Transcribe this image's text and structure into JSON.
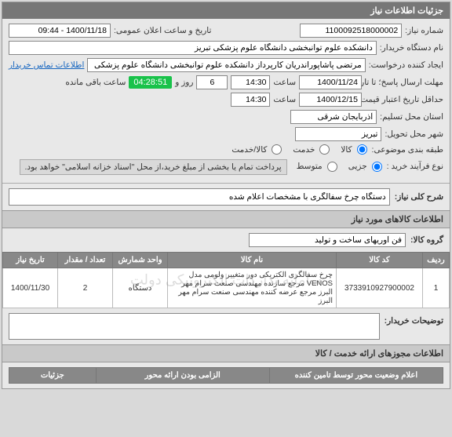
{
  "header": {
    "title": "جزئیات اطلاعات نیاز"
  },
  "form": {
    "need_no_label": "شماره نیاز:",
    "need_no": "1100092518000002",
    "announce_label": "تاریخ و ساعت اعلان عمومی:",
    "announce_value": "1400/11/18 - 09:44",
    "buyer_label": "نام دستگاه خریدار:",
    "buyer_value": "دانشکده علوم توانبخشی دانشگاه علوم پزشکی تبریز",
    "creator_label": "ایجاد کننده درخواست:",
    "creator_value": "مرتضی پاشاپوراندریان کارپرداز دانشکده علوم توانبخشی دانشگاه علوم پزشکی",
    "contact_link": "اطلاعات تماس خریدار",
    "deadline_answer_label": "مهلت ارسال پاسخ؛ تا تاریخ:",
    "deadline_date": "1400/11/24",
    "time_label": "ساعت",
    "deadline_time": "14:30",
    "days_label": "روز و",
    "days_value": "6",
    "remain_label": "ساعت باقی مانده",
    "remain_timer": "04:28:51",
    "min_credit_label": "حداقل تاریخ اعتبار قیمت؛ تا تاریخ:",
    "min_credit_date": "1400/12/15",
    "min_credit_time": "14:30",
    "province_label": "استان محل تسليم:",
    "province_value": "آذربایجان شرقی",
    "city_label": "شهر محل تحویل:",
    "city_value": "تبریز",
    "category_label": "طبقه بندی موضوعی:",
    "cat_goods": "کالا",
    "cat_service": "خدمت",
    "cat_goods_service": "کالا/خدمت",
    "buy_type_label": "نوع فرآیند خرید :",
    "bt_minor": "جزیی",
    "bt_medium": "متوسط",
    "bt_note": "پرداخت تمام یا بخشی از مبلغ خرید،از محل \"اسناد خزانه اسلامی\" خواهد بود."
  },
  "desc": {
    "label": "شرح کلی نیاز:",
    "value": "دستگاه چرخ سفالگری با مشخصات اعلام شده"
  },
  "items_section": {
    "title": "اطلاعات کالاهای مورد نیاز",
    "group_label": "گروه کالا:",
    "group_value": "فن آوریهای ساخت و تولید",
    "watermark": "سامانه تدارکات الکترونیکی دولت",
    "cols": {
      "row": "ردیف",
      "code": "کد کالا",
      "name": "نام کالا",
      "unit": "واحد شمارش",
      "qty": "تعداد / مقدار",
      "date": "تاریخ نیاز"
    },
    "rows": [
      {
        "idx": "1",
        "code": "3733910927900002",
        "name": "چرخ سفالگری الکتریکی دور متغییر ولومی مدل VENOS مرجع سازنده مهندسی صنعت سرام مهر البرز مرجع عرضه کننده مهندسی صنعت سرام مهر البرز",
        "unit": "دستگاه",
        "qty": "2",
        "date": "1400/11/30"
      }
    ]
  },
  "buyer_notes": {
    "label": "توضیحات خریدار:"
  },
  "licenses": {
    "title": "اطلاعات مجوزهای ارائه خدمت / کالا"
  },
  "footer": {
    "status_label": "اعلام وضعیت محور توسط تامین کننده",
    "mandatory_label": "الزامی بودن ارائه محور",
    "details": "جزئیات"
  }
}
